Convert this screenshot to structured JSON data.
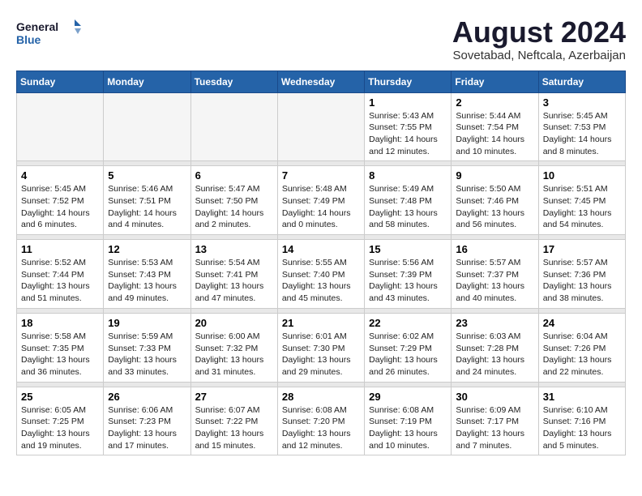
{
  "logo": {
    "line1": "General",
    "line2": "Blue"
  },
  "title": "August 2024",
  "subtitle": "Sovetabad, Neftcala, Azerbaijan",
  "days_header": [
    "Sunday",
    "Monday",
    "Tuesday",
    "Wednesday",
    "Thursday",
    "Friday",
    "Saturday"
  ],
  "weeks": [
    [
      {
        "day": "",
        "info": ""
      },
      {
        "day": "",
        "info": ""
      },
      {
        "day": "",
        "info": ""
      },
      {
        "day": "",
        "info": ""
      },
      {
        "day": "1",
        "info": "Sunrise: 5:43 AM\nSunset: 7:55 PM\nDaylight: 14 hours\nand 12 minutes."
      },
      {
        "day": "2",
        "info": "Sunrise: 5:44 AM\nSunset: 7:54 PM\nDaylight: 14 hours\nand 10 minutes."
      },
      {
        "day": "3",
        "info": "Sunrise: 5:45 AM\nSunset: 7:53 PM\nDaylight: 14 hours\nand 8 minutes."
      }
    ],
    [
      {
        "day": "4",
        "info": "Sunrise: 5:45 AM\nSunset: 7:52 PM\nDaylight: 14 hours\nand 6 minutes."
      },
      {
        "day": "5",
        "info": "Sunrise: 5:46 AM\nSunset: 7:51 PM\nDaylight: 14 hours\nand 4 minutes."
      },
      {
        "day": "6",
        "info": "Sunrise: 5:47 AM\nSunset: 7:50 PM\nDaylight: 14 hours\nand 2 minutes."
      },
      {
        "day": "7",
        "info": "Sunrise: 5:48 AM\nSunset: 7:49 PM\nDaylight: 14 hours\nand 0 minutes."
      },
      {
        "day": "8",
        "info": "Sunrise: 5:49 AM\nSunset: 7:48 PM\nDaylight: 13 hours\nand 58 minutes."
      },
      {
        "day": "9",
        "info": "Sunrise: 5:50 AM\nSunset: 7:46 PM\nDaylight: 13 hours\nand 56 minutes."
      },
      {
        "day": "10",
        "info": "Sunrise: 5:51 AM\nSunset: 7:45 PM\nDaylight: 13 hours\nand 54 minutes."
      }
    ],
    [
      {
        "day": "11",
        "info": "Sunrise: 5:52 AM\nSunset: 7:44 PM\nDaylight: 13 hours\nand 51 minutes."
      },
      {
        "day": "12",
        "info": "Sunrise: 5:53 AM\nSunset: 7:43 PM\nDaylight: 13 hours\nand 49 minutes."
      },
      {
        "day": "13",
        "info": "Sunrise: 5:54 AM\nSunset: 7:41 PM\nDaylight: 13 hours\nand 47 minutes."
      },
      {
        "day": "14",
        "info": "Sunrise: 5:55 AM\nSunset: 7:40 PM\nDaylight: 13 hours\nand 45 minutes."
      },
      {
        "day": "15",
        "info": "Sunrise: 5:56 AM\nSunset: 7:39 PM\nDaylight: 13 hours\nand 43 minutes."
      },
      {
        "day": "16",
        "info": "Sunrise: 5:57 AM\nSunset: 7:37 PM\nDaylight: 13 hours\nand 40 minutes."
      },
      {
        "day": "17",
        "info": "Sunrise: 5:57 AM\nSunset: 7:36 PM\nDaylight: 13 hours\nand 38 minutes."
      }
    ],
    [
      {
        "day": "18",
        "info": "Sunrise: 5:58 AM\nSunset: 7:35 PM\nDaylight: 13 hours\nand 36 minutes."
      },
      {
        "day": "19",
        "info": "Sunrise: 5:59 AM\nSunset: 7:33 PM\nDaylight: 13 hours\nand 33 minutes."
      },
      {
        "day": "20",
        "info": "Sunrise: 6:00 AM\nSunset: 7:32 PM\nDaylight: 13 hours\nand 31 minutes."
      },
      {
        "day": "21",
        "info": "Sunrise: 6:01 AM\nSunset: 7:30 PM\nDaylight: 13 hours\nand 29 minutes."
      },
      {
        "day": "22",
        "info": "Sunrise: 6:02 AM\nSunset: 7:29 PM\nDaylight: 13 hours\nand 26 minutes."
      },
      {
        "day": "23",
        "info": "Sunrise: 6:03 AM\nSunset: 7:28 PM\nDaylight: 13 hours\nand 24 minutes."
      },
      {
        "day": "24",
        "info": "Sunrise: 6:04 AM\nSunset: 7:26 PM\nDaylight: 13 hours\nand 22 minutes."
      }
    ],
    [
      {
        "day": "25",
        "info": "Sunrise: 6:05 AM\nSunset: 7:25 PM\nDaylight: 13 hours\nand 19 minutes."
      },
      {
        "day": "26",
        "info": "Sunrise: 6:06 AM\nSunset: 7:23 PM\nDaylight: 13 hours\nand 17 minutes."
      },
      {
        "day": "27",
        "info": "Sunrise: 6:07 AM\nSunset: 7:22 PM\nDaylight: 13 hours\nand 15 minutes."
      },
      {
        "day": "28",
        "info": "Sunrise: 6:08 AM\nSunset: 7:20 PM\nDaylight: 13 hours\nand 12 minutes."
      },
      {
        "day": "29",
        "info": "Sunrise: 6:08 AM\nSunset: 7:19 PM\nDaylight: 13 hours\nand 10 minutes."
      },
      {
        "day": "30",
        "info": "Sunrise: 6:09 AM\nSunset: 7:17 PM\nDaylight: 13 hours\nand 7 minutes."
      },
      {
        "day": "31",
        "info": "Sunrise: 6:10 AM\nSunset: 7:16 PM\nDaylight: 13 hours\nand 5 minutes."
      }
    ]
  ]
}
